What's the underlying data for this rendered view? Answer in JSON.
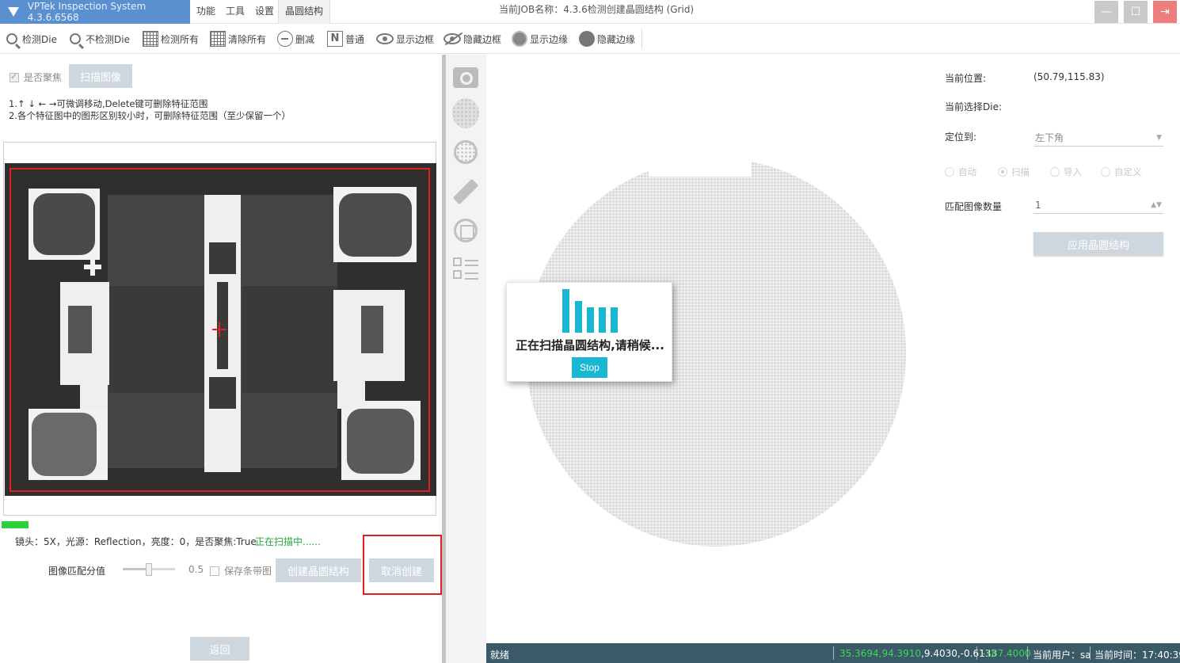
{
  "titlebar": {
    "app_title": "VPTek Inspection System 4.3.6.6568",
    "menus": [
      "功能",
      "工具",
      "设置",
      "晶圆结构"
    ],
    "job_label": "当前JOB名称：4.3.6检测创建晶圆结构 (Grid)",
    "window_buttons": [
      "minimize-icon",
      "maximize-icon",
      "exit-icon"
    ],
    "colors": {
      "title_bg": "#5a8fd0",
      "exit_btn": "#ee7d7d"
    }
  },
  "toolbar": {
    "items": [
      {
        "label": "检测Die",
        "icon": "magnifier-icon"
      },
      {
        "label": "不检测Die",
        "icon": "magnifier-icon"
      },
      {
        "label": "检测所有",
        "icon": "grid-icon"
      },
      {
        "label": "清除所有",
        "icon": "grid-icon"
      },
      {
        "label": "删减",
        "icon": "minus-circle-icon"
      },
      {
        "label": "普通",
        "icon": "n-box-icon"
      },
      {
        "label": "显示边框",
        "icon": "eye-icon"
      },
      {
        "label": "隐藏边框",
        "icon": "eye-off-icon"
      },
      {
        "label": "显示边缘",
        "icon": "circle-icon"
      },
      {
        "label": "隐藏边缘",
        "icon": "filled-circle-icon"
      }
    ]
  },
  "left": {
    "focus_label": "是否聚焦",
    "focus_checked": true,
    "scan_image_label": "扫描图像",
    "hint_line1": "1.↑ ↓ ← →可微调移动,Delete键可删除特征范围",
    "hint_line2": "2.各个特征图中的图形区别较小时，可删除特征范围（至少保留一个）",
    "lens_info": "镜头：5X，光源：Reflection，亮度：0，是否聚焦:True",
    "scan_status": "正在扫描中......",
    "match_label": "图像匹配分值",
    "match_value": "0.5",
    "match_fraction": 0.5,
    "save_strip_label": "保存条带图",
    "create_label": "创建晶圆结构",
    "cancel_label": "取消创建",
    "back_label": "返回",
    "colors": {
      "progress": "#2bd13a",
      "status": "#26a83c",
      "highlight": "#e02020"
    }
  },
  "side_tools": [
    "camera-icon",
    "wafer-icon",
    "wafer-ring-icon",
    "ruler-icon",
    "frame-icon",
    "checklist-icon"
  ],
  "dialog": {
    "message": "正在扫描晶圆结构,请稍候...",
    "stop_label": "Stop",
    "accent": "#1ab7d3"
  },
  "right": {
    "position_label": "当前位置:",
    "position_value": "(50.79,115.83)",
    "selected_die_label": "当前选择Die:",
    "locate_label": "定位到:",
    "locate_value": "左下角",
    "radios": [
      {
        "label": "自动",
        "selected": false
      },
      {
        "label": "扫描",
        "selected": true
      },
      {
        "label": "导入",
        "selected": false
      },
      {
        "label": "自定义",
        "selected": false
      }
    ],
    "match_count_label": "匹配图像数量",
    "match_count_value": "1",
    "apply_label": "应用晶圆结构"
  },
  "statusbar": {
    "ready": "就绪",
    "coords_green": "35.3694,94.3910",
    "coords_white": ",9.4030,-0.6133",
    "value_green": "-187.4000",
    "user": "当前用户：sa",
    "time": "当前时间：17:40:39",
    "bg": "#3b5a67"
  }
}
